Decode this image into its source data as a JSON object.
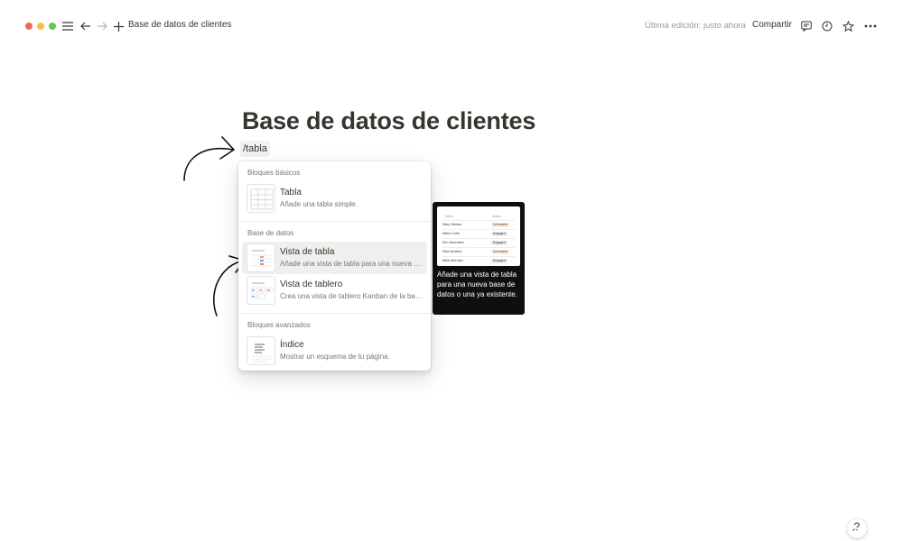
{
  "window": {
    "colors": {
      "close": "#ed6a5e",
      "minimize": "#f5bf4f",
      "zoom": "#62c554"
    }
  },
  "topbar": {
    "breadcrumb": "Base de datos de clientes",
    "last_edited": "Última edición: justo ahora",
    "share_label": "Compartir",
    "icons": [
      "menu-icon",
      "back-arrow-icon",
      "forward-arrow-icon",
      "plus-icon",
      "comment-icon",
      "clock-icon",
      "star-icon",
      "more-icon"
    ]
  },
  "page": {
    "title": "Base de datos de clientes",
    "command_text": "/tabla"
  },
  "slash_menu": {
    "sections": [
      {
        "label": "Bloques básicos",
        "items": [
          {
            "title": "Tabla",
            "description": "Añade una tabla simple.",
            "icon": "simple-table-icon"
          }
        ]
      },
      {
        "label": "Base de datos",
        "items": [
          {
            "title": "Vista de tabla",
            "description": "Añade una vista de tabla para una nueva base de datos o una ya existente.",
            "icon": "table-view-icon",
            "selected": true
          },
          {
            "title": "Vista de tablero",
            "description": "Crea una vista de tablero Kanban de la base de datos.",
            "icon": "board-view-icon"
          }
        ]
      },
      {
        "label": "Bloques avanzados",
        "items": [
          {
            "title": "Índice",
            "description": "Mostrar un esquema de tu página.",
            "icon": "table-of-contents-icon"
          }
        ]
      }
    ]
  },
  "tooltip": {
    "preview": {
      "columns": [
        "Name",
        "Status"
      ],
      "rows": [
        {
          "name": "Mary Weeks",
          "status": "Scheduled"
        },
        {
          "name": "Mitch Colin",
          "status": "Engaged"
        },
        {
          "name": "Kim Saunders",
          "status": "Engaged"
        },
        {
          "name": "Stan Alvarez",
          "status": "Scheduled"
        },
        {
          "name": "Mike Mendez",
          "status": "Engaged"
        }
      ],
      "status_colors": {
        "Scheduled": "#fbecdd",
        "Engaged": "#ededeb"
      }
    },
    "text": "Añade una vista de tabla para una nueva base de datos o una ya existente."
  },
  "help": {
    "icon": "help-icon"
  }
}
